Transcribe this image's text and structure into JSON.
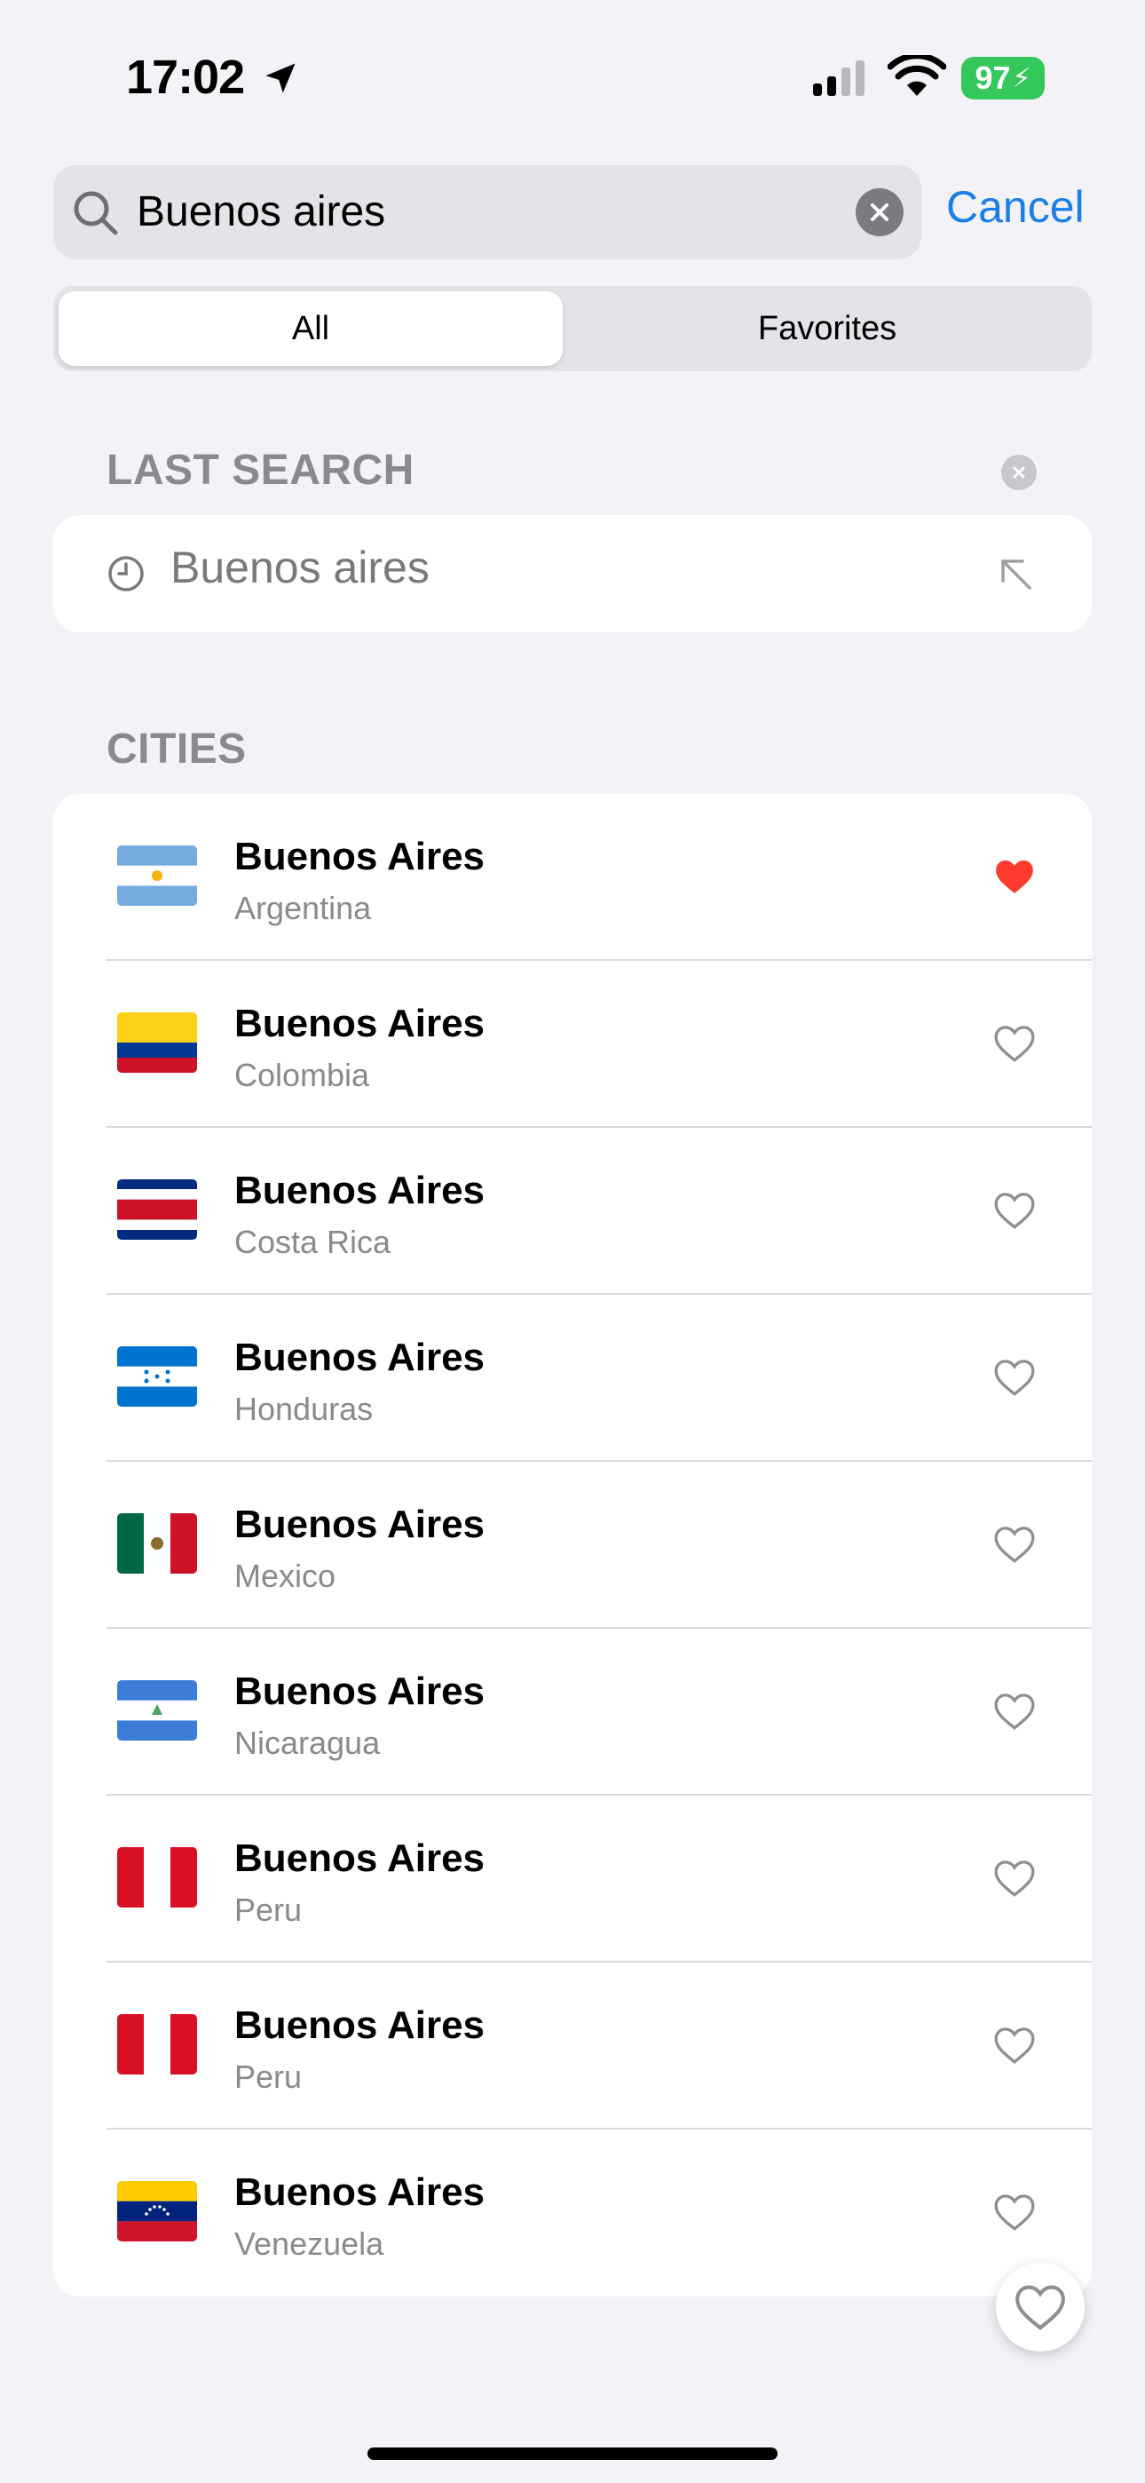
{
  "status_bar": {
    "time": "17:02",
    "battery": "97"
  },
  "search": {
    "value": "Buenos aires",
    "cancel_label": "Cancel"
  },
  "segments": {
    "all": "All",
    "favorites": "Favorites"
  },
  "last_search": {
    "header": "LAST SEARCH",
    "item": "Buenos aires"
  },
  "cities": {
    "header": "CITIES",
    "items": [
      {
        "city": "Buenos Aires",
        "country": "Argentina",
        "favorite": true,
        "flag": "argentina-flag-icon"
      },
      {
        "city": "Buenos Aires",
        "country": "Colombia",
        "favorite": false,
        "flag": "colombia-flag-icon"
      },
      {
        "city": "Buenos Aires",
        "country": "Costa Rica",
        "favorite": false,
        "flag": "costa-rica-flag-icon"
      },
      {
        "city": "Buenos Aires",
        "country": "Honduras",
        "favorite": false,
        "flag": "honduras-flag-icon"
      },
      {
        "city": "Buenos Aires",
        "country": "Mexico",
        "favorite": false,
        "flag": "mexico-flag-icon"
      },
      {
        "city": "Buenos Aires",
        "country": "Nicaragua",
        "favorite": false,
        "flag": "nicaragua-flag-icon"
      },
      {
        "city": "Buenos Aires",
        "country": "Peru",
        "favorite": false,
        "flag": "peru-flag-icon"
      },
      {
        "city": "Buenos Aires",
        "country": "Peru",
        "favorite": false,
        "flag": "peru-flag-icon"
      },
      {
        "city": "Buenos Aires",
        "country": "Venezuela",
        "favorite": false,
        "flag": "venezuela-flag-icon"
      }
    ]
  },
  "colors": {
    "accent": "#1A7FE8",
    "favorite": "#FF3B30",
    "battery": "#34C759"
  }
}
